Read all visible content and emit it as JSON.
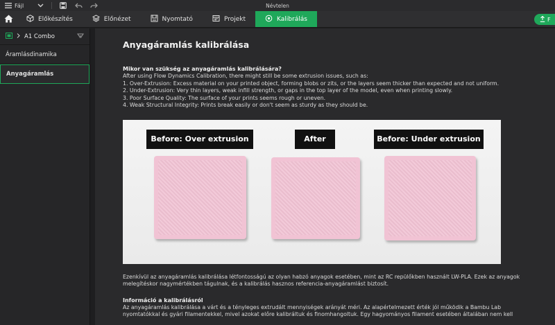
{
  "titlebar": {
    "file_menu": "Fájl",
    "window_title": "Névtelen"
  },
  "tabs": [
    {
      "label": "Előkészítés"
    },
    {
      "label": "Előnézet"
    },
    {
      "label": "Nyomtató"
    },
    {
      "label": "Projekt"
    },
    {
      "label": "Kalibrálás"
    }
  ],
  "right_button_label": "F",
  "sidebar": {
    "printer": "A1 Combo",
    "items": [
      {
        "label": "Áramlásdinamika"
      },
      {
        "label": "Anyagáramlás"
      }
    ]
  },
  "main": {
    "title": "Anyagáramlás kalibrálása",
    "section1_heading": "Mikor van szükség az anyagáramlás kalibrálására?",
    "section1_lines": [
      "After using Flow Dynamics Calibration, there might still be some extrusion issues, such as:",
      "1. Over-Extrusion: Excess material on your printed object, forming blobs or zits, or the layers seem thicker than expected and not uniform.",
      "2. Under-Extrusion: Very thin layers, weak infill strength, or gaps in the top layer of the model, even when printing slowly.",
      "3. Poor Surface Quality: The surface of your prints seems rough or uneven.",
      "4. Weak Structural Integrity: Prints break easily or don't seem as sturdy as they should be."
    ],
    "image_labels": {
      "over": "Before: Over extrusion",
      "after": "After",
      "under": "Before: Under extrusion"
    },
    "para2": "Ezenkívül az anyagáramlás kalibrálása létfontosságú az olyan habzó anyagok esetében, mint az RC repülőkben használt LW-PLA. Ezek az anyagok melegítéskor nagymértékben tágulnak, és a kalibrálás hasznos referencia-anyagáramlást biztosít.",
    "section2_heading": "Információ a kalibrálásról",
    "section2_text": "Az anyagáramlás kalibrálása a várt és a tényleges extrudált mennyiségek arányát méri. Az alapértelmezett érték jól működik a Bambu Lab nyomtatókkal és gyári filamentekkel, mivel azokat előre kalibráltuk és finomhangoltuk. Egy hagyományos filament esetében általában nem kell"
  },
  "colors": {
    "accent": "#1fa85a",
    "sample_pink": "#f1c3d4"
  }
}
